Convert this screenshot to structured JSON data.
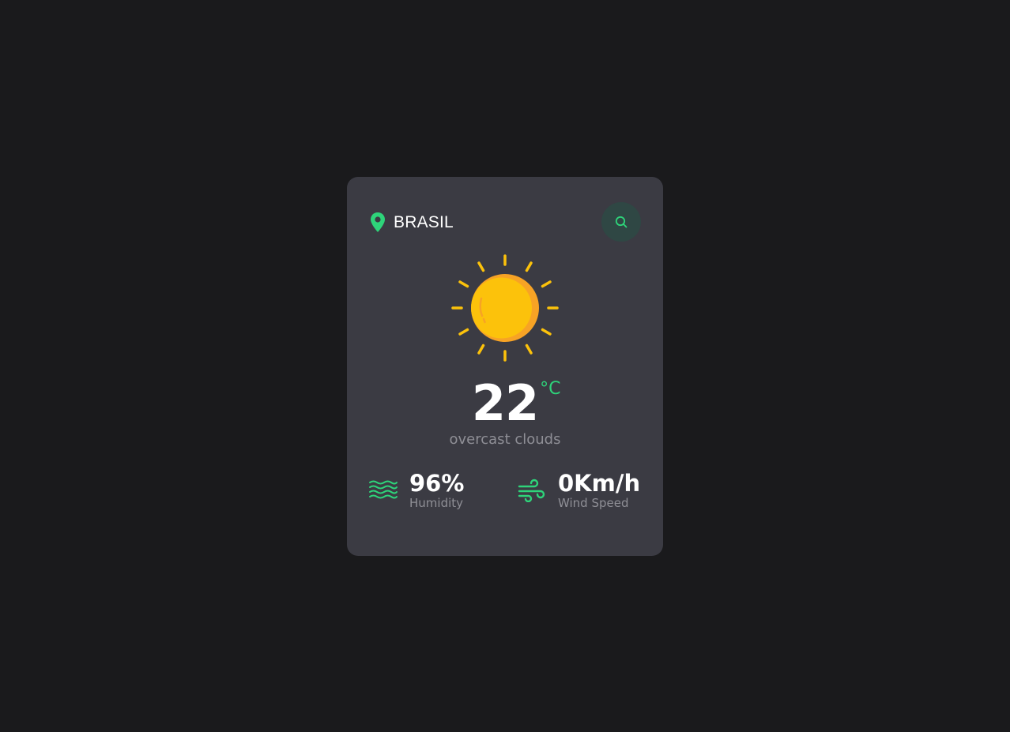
{
  "location": {
    "icon": "map-pin-icon",
    "name": "BRASIL"
  },
  "search": {
    "icon": "search-icon"
  },
  "current": {
    "icon": "sun-icon",
    "temperature": "22",
    "unit": "°C",
    "description": "overcast clouds"
  },
  "stats": {
    "humidity": {
      "icon": "waves-icon",
      "value": "96%",
      "label": "Humidity"
    },
    "wind": {
      "icon": "wind-icon",
      "value": "0Km/h",
      "label": "Wind Speed"
    }
  },
  "colors": {
    "background": "#1a1a1c",
    "card": "#3b3b43",
    "accent": "#2ed47a",
    "sun": "#fcc20b",
    "sun_shade": "#f7a325",
    "muted_text": "#8f8f96"
  }
}
